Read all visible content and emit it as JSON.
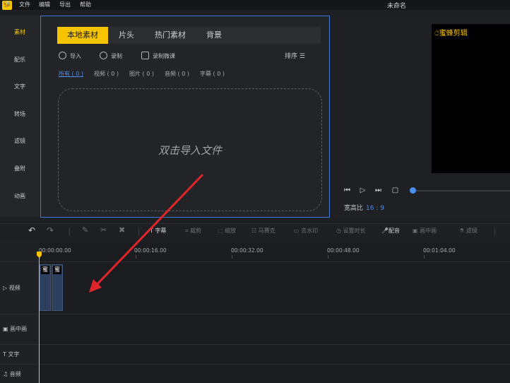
{
  "app": {
    "logo": "🐝",
    "menus": [
      "文件",
      "编辑",
      "导出",
      "帮助"
    ],
    "window_title": "未命名"
  },
  "categories": [
    {
      "label": "素材",
      "active": true
    },
    {
      "label": "配乐"
    },
    {
      "label": "文字"
    },
    {
      "label": "转场"
    },
    {
      "label": "滤镜"
    },
    {
      "label": "叠附"
    },
    {
      "label": "动画"
    }
  ],
  "media": {
    "tabs": [
      "本地素材",
      "片头",
      "热门素材",
      "背景"
    ],
    "tools": [
      "导入",
      "录制",
      "录制微课"
    ],
    "sort_label": "排序 ☰",
    "filters": [
      "所有 ( 0 )",
      "视频 ( 0 )",
      "图片 ( 0 )",
      "音频 ( 0 )",
      "字幕 ( 0 )"
    ],
    "drop_text": "双击导入文件"
  },
  "preview": {
    "watermark": "蜜蜂剪辑",
    "ratio_label": "宽高比",
    "ratio_value": "16 : 9"
  },
  "edit_tools": [
    "字幕",
    "裁剪",
    "缩放",
    "马赛克",
    "去水印",
    "设置时长",
    "配音",
    "画中画",
    "滤镜"
  ],
  "timeline": {
    "ruler": [
      "00:00:00.00",
      "00:00:16.00",
      "00:00:32.00",
      "00:00:48.00",
      "00:01:04.00"
    ],
    "tracks": [
      "视频",
      "画中画",
      "文字",
      "音频"
    ],
    "clip_caption": "蜜"
  },
  "colors": {
    "accent": "#f7c500",
    "link": "#4a8ef0",
    "selection_border": "#3b7bd8",
    "annotation_arrow": "#e0252a"
  }
}
